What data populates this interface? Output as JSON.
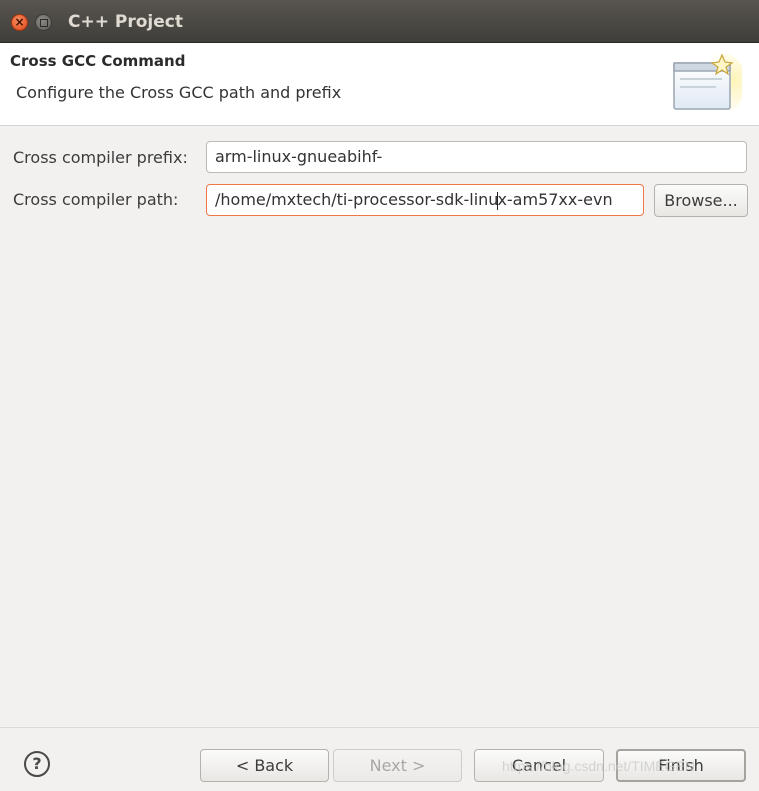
{
  "window": {
    "title": "C++ Project"
  },
  "banner": {
    "heading": "Cross GCC Command",
    "description": "Configure the Cross GCC path and prefix"
  },
  "form": {
    "prefix_label": "Cross compiler prefix:",
    "prefix_value": "arm-linux-gnueabihf-",
    "path_label": "Cross compiler path:",
    "path_value_before_caret": "/home/mxtech/ti-processor-sdk-linu",
    "path_value_after_caret": "x-am57xx-evn",
    "browse_label": "Browse..."
  },
  "footer": {
    "help_symbol": "?",
    "back_label": "< Back",
    "next_label": "Next >",
    "cancel_label": "Cancel",
    "finish_label": "Finish"
  },
  "watermark": "https://blog.csdn.net/TIMEGEN",
  "colors": {
    "focus_border": "#f07746",
    "close_button": "#e0491b"
  }
}
